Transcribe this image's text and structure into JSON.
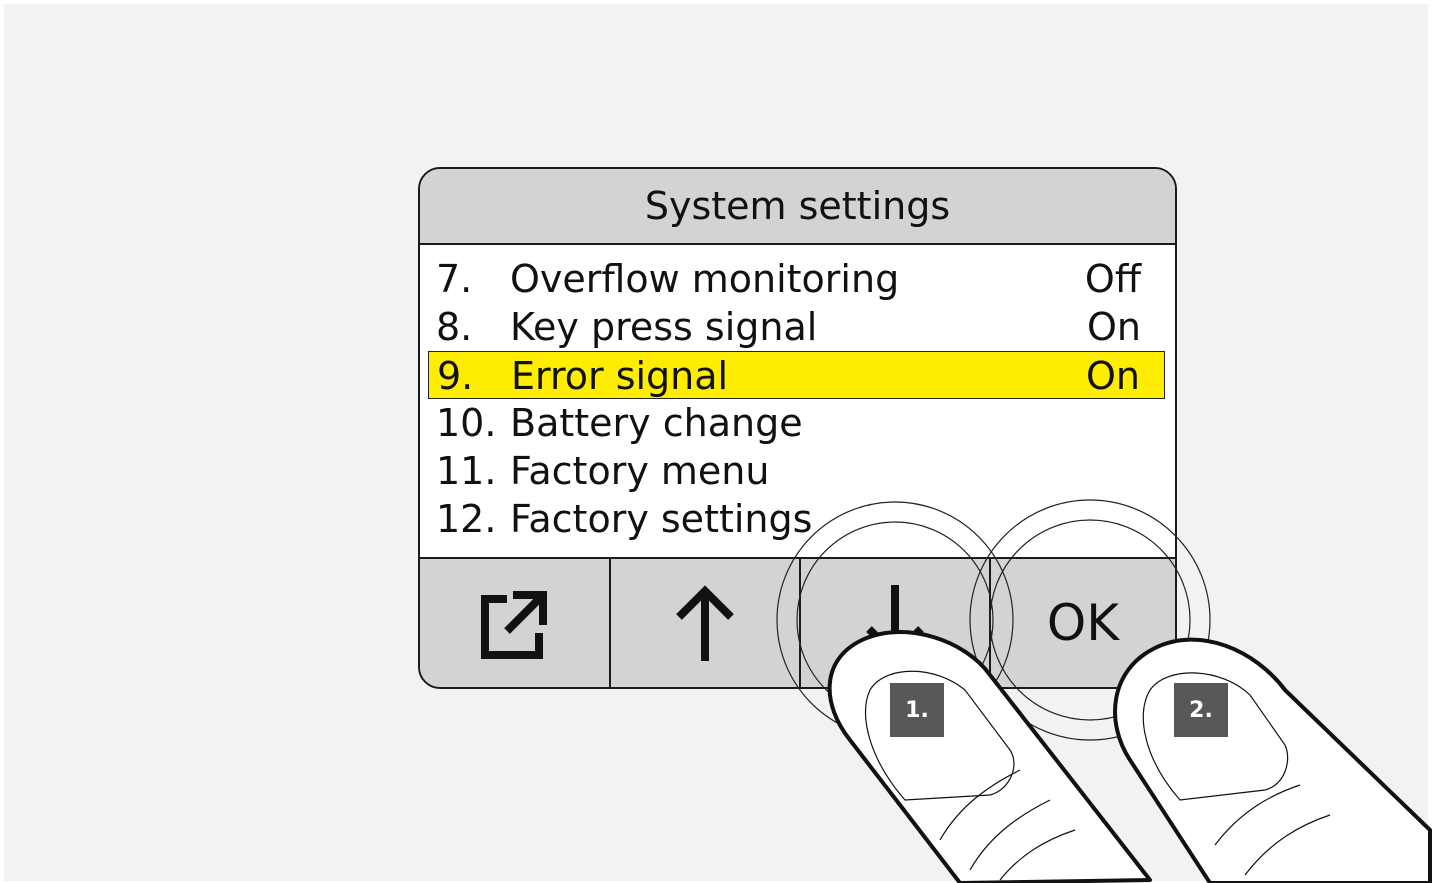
{
  "screen": {
    "title": "System settings",
    "items": [
      {
        "num": "7.",
        "label": "Overflow monitoring",
        "value": "Off",
        "selected": false
      },
      {
        "num": "8.",
        "label": "Key press signal",
        "value": "On",
        "selected": false
      },
      {
        "num": "9.",
        "label": "Error signal",
        "value": "On",
        "selected": true
      },
      {
        "num": "10.",
        "label": "Battery change",
        "value": "",
        "selected": false
      },
      {
        "num": "11.",
        "label": "Factory menu",
        "value": "",
        "selected": false
      },
      {
        "num": "12.",
        "label": "Factory settings",
        "value": "",
        "selected": false
      }
    ],
    "highlight_color": "#ffed00"
  },
  "soft_keys": [
    {
      "name": "exit",
      "icon": "exit-icon"
    },
    {
      "name": "up",
      "icon": "arrow-up-icon"
    },
    {
      "name": "down",
      "icon": "arrow-down-icon"
    },
    {
      "name": "ok",
      "label": "OK"
    }
  ],
  "steps": [
    {
      "label": "1.",
      "target": "down"
    },
    {
      "label": "2.",
      "target": "ok"
    }
  ]
}
